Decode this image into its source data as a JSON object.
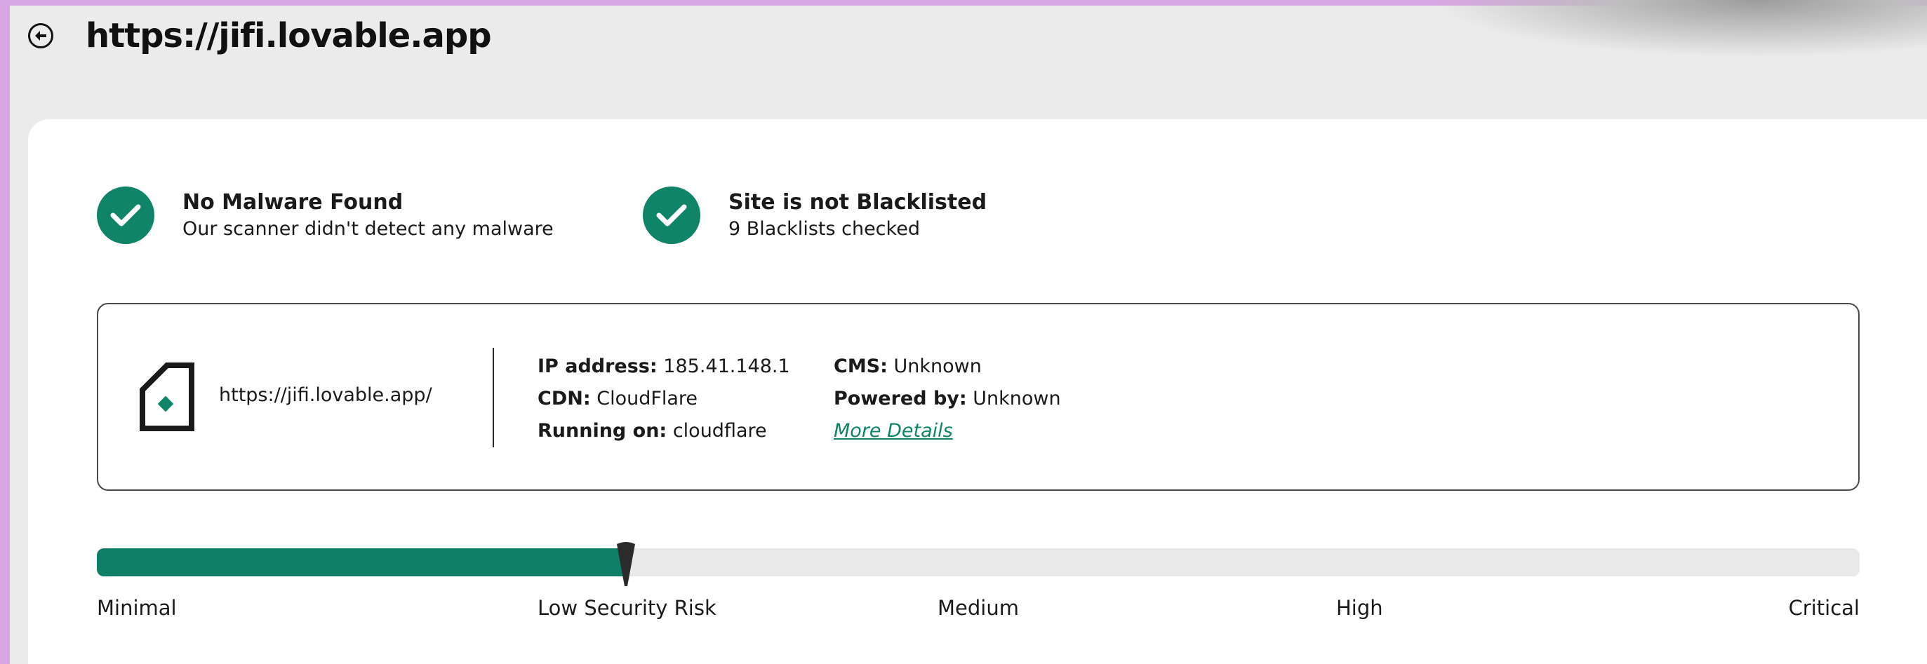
{
  "header": {
    "url": "https://jifi.lovable.app",
    "back_icon": "back-arrow-circle-icon"
  },
  "status": {
    "malware": {
      "title": "No Malware Found",
      "subtitle": "Our scanner didn't detect any malware",
      "icon": "check-circle-icon"
    },
    "blacklist": {
      "title": "Site is not Blacklisted",
      "subtitle": "9 Blacklists checked",
      "icon": "check-circle-icon"
    }
  },
  "site_info": {
    "icon": "site-document-icon",
    "url": "https://jifi.lovable.app/",
    "ip_label": "IP address:",
    "ip_value": "185.41.148.1",
    "cdn_label": "CDN:",
    "cdn_value": "CloudFlare",
    "running_label": "Running on:",
    "running_value": "cloudflare",
    "cms_label": "CMS:",
    "cms_value": "Unknown",
    "powered_label": "Powered by:",
    "powered_value": "Unknown",
    "more_details": "More Details"
  },
  "risk": {
    "level_fraction": 0.3,
    "labels": [
      "Minimal",
      "Low Security Risk",
      "Medium",
      "High",
      "Critical"
    ]
  },
  "colors": {
    "accent": "#108468",
    "frame": "#d8a6e2",
    "track": "#e9e9e9"
  }
}
